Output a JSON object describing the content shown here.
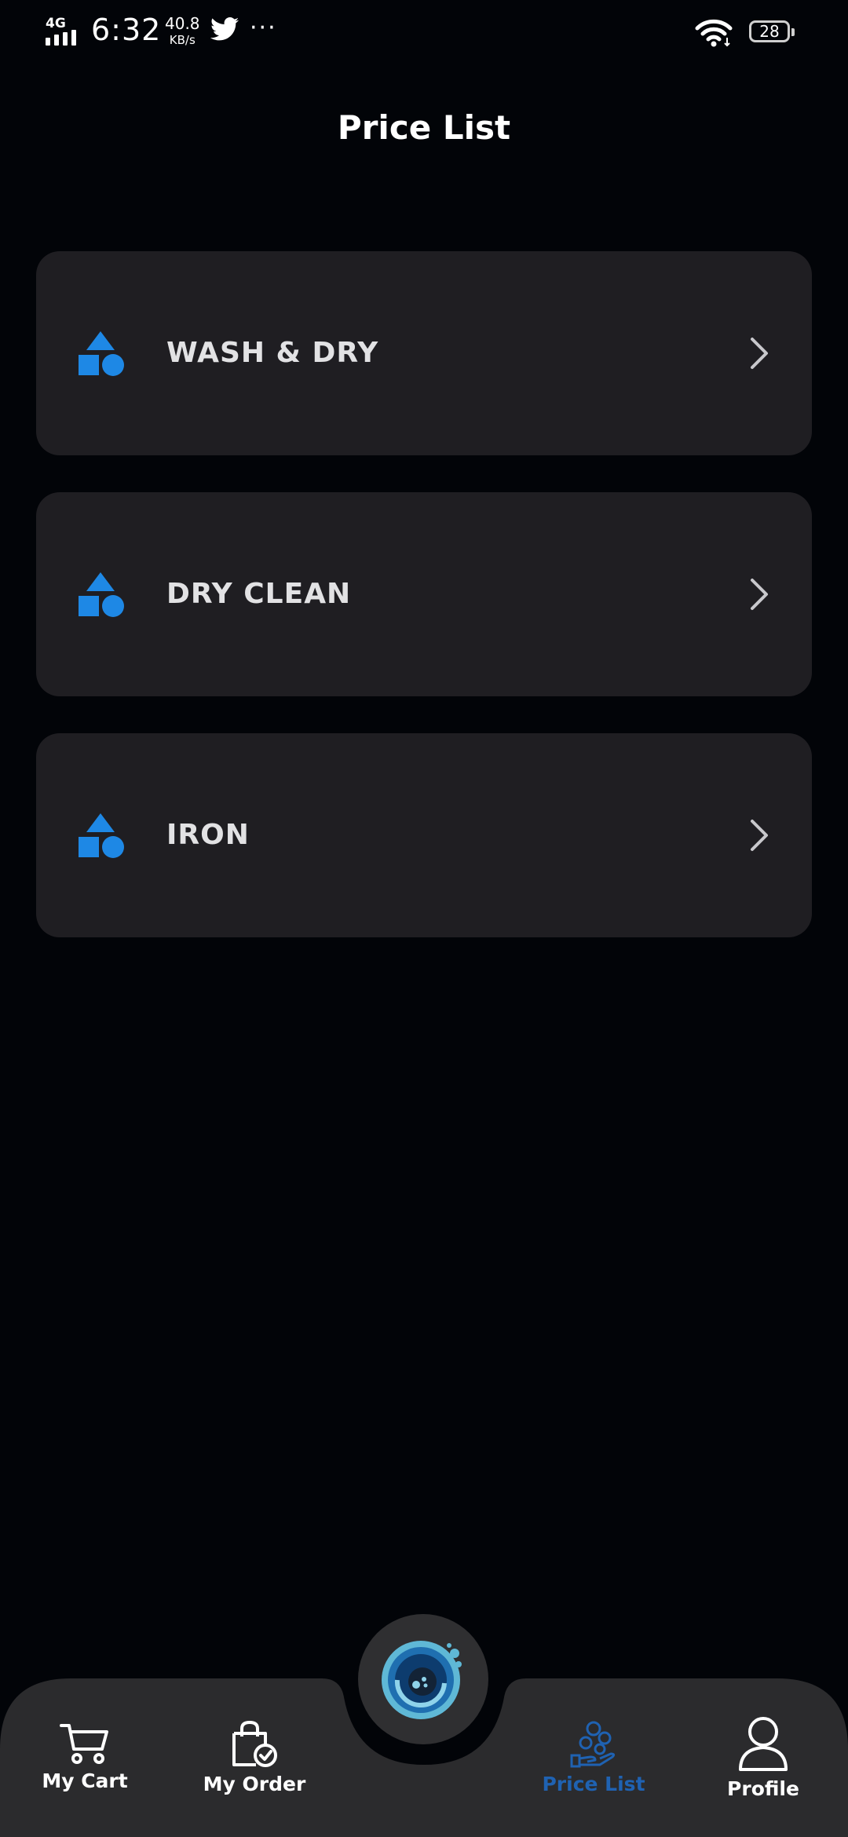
{
  "status_bar": {
    "network": "4G",
    "time": "6:32",
    "speed_value": "40.8",
    "speed_unit": "KB/s",
    "more": "···",
    "battery": "28"
  },
  "header": {
    "title": "Price List"
  },
  "services": [
    {
      "label": "WASH & DRY",
      "icon": "shapes-icon"
    },
    {
      "label": "DRY CLEAN",
      "icon": "shapes-icon"
    },
    {
      "label": "IRON",
      "icon": "shapes-icon"
    }
  ],
  "bottom_nav": {
    "items": [
      {
        "label": "My Cart",
        "icon": "cart-icon"
      },
      {
        "label": "My Order",
        "icon": "shopping-bag-check-icon"
      },
      {
        "label": "Price List",
        "icon": "price-list-icon",
        "active": true
      },
      {
        "label": "Profile",
        "icon": "user-icon"
      }
    ],
    "center_button": {
      "icon": "app-logo-icon"
    }
  },
  "colors": {
    "background": "#020408",
    "card": "#1f1e22",
    "accent_icon": "#1e88e5",
    "active_nav": "#1f62b2",
    "nav_bar": "#2b2b2d"
  }
}
